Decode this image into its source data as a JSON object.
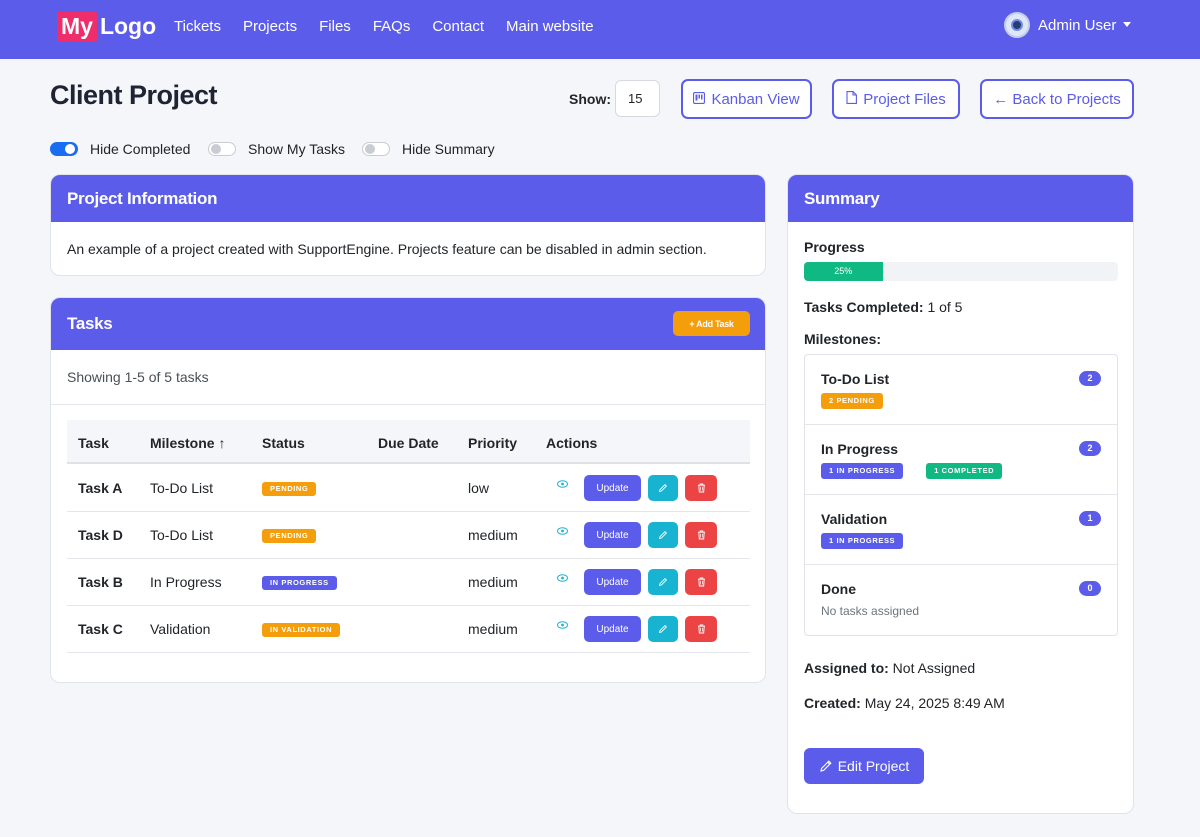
{
  "nav": {
    "logo_box": "My",
    "logo_text": "Logo",
    "links": [
      "Tickets",
      "Projects",
      "Files",
      "FAQs",
      "Contact",
      "Main website"
    ],
    "user": "Admin User"
  },
  "header": {
    "title": "Client Project",
    "show_label": "Show:",
    "show_value": "15",
    "kanban": "Kanban View",
    "files": "Project Files",
    "back": "← Back to Projects"
  },
  "toggles": [
    {
      "label": "Hide Completed",
      "on": true
    },
    {
      "label": "Show My Tasks",
      "on": false
    },
    {
      "label": "Hide Summary",
      "on": false
    }
  ],
  "info": {
    "title": "Project Information",
    "text": "An example of a project created with SupportEngine. Projects feature can be disabled in admin section."
  },
  "tasks": {
    "title": "Tasks",
    "add_label": "+ Add Task",
    "showing": "Showing 1-5 of 5 tasks",
    "columns": [
      "Task",
      "Milestone ↑",
      "Status",
      "Due Date",
      "Priority",
      "Actions"
    ],
    "update_label": "Update",
    "rows": [
      {
        "task": "Task A",
        "milestone": "To-Do List",
        "status": "PENDING",
        "status_color": "#f59e0b",
        "due": "",
        "priority": "low"
      },
      {
        "task": "Task D",
        "milestone": "To-Do List",
        "status": "PENDING",
        "status_color": "#f59e0b",
        "due": "",
        "priority": "medium"
      },
      {
        "task": "Task B",
        "milestone": "In Progress",
        "status": "IN PROGRESS",
        "status_color": "#5b5ce9",
        "due": "",
        "priority": "medium"
      },
      {
        "task": "Task C",
        "milestone": "Validation",
        "status": "IN VALIDATION",
        "status_color": "#f59e0b",
        "due": "",
        "priority": "medium"
      }
    ]
  },
  "summary": {
    "title": "Summary",
    "progress_label": "Progress",
    "progress_value": 25,
    "progress_text": "25%",
    "tasks_completed_label": "Tasks Completed:",
    "tasks_completed_value": "1 of 5",
    "milestones_label": "Milestones:",
    "milestones": [
      {
        "name": "To-Do List",
        "count": "2",
        "badges": [
          {
            "text": "2 PENDING",
            "color": "#f59e0b"
          }
        ],
        "note": ""
      },
      {
        "name": "In Progress",
        "count": "2",
        "badges": [
          {
            "text": "1 IN PROGRESS",
            "color": "#5b5ce9"
          },
          {
            "text": "1 COMPLETED",
            "color": "#10b981"
          }
        ],
        "note": ""
      },
      {
        "name": "Validation",
        "count": "1",
        "badges": [
          {
            "text": "1 IN PROGRESS",
            "color": "#5b5ce9"
          }
        ],
        "note": ""
      },
      {
        "name": "Done",
        "count": "0",
        "badges": [],
        "note": "No tasks assigned"
      }
    ],
    "assigned_label": "Assigned to:",
    "assigned_value": "Not Assigned",
    "created_label": "Created:",
    "created_value": "May 24, 2025 8:49 AM",
    "edit_label": "Edit Project"
  },
  "colors": {
    "primary": "#5b5ce9",
    "warning": "#f59e0b",
    "success": "#10b981",
    "info": "#17b3d1",
    "danger": "#ec4444"
  }
}
